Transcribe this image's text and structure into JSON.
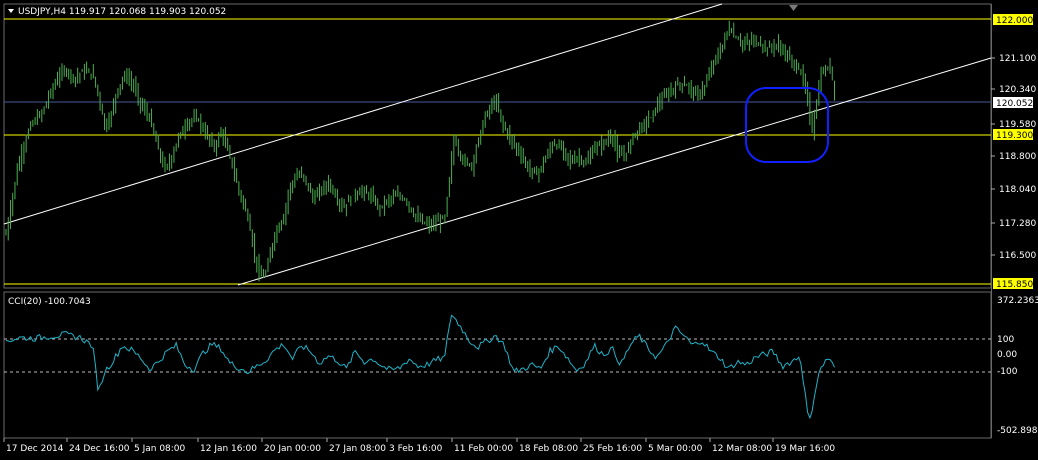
{
  "window": {
    "header_label": "USDJPY,H4  119.917 120.068 119.903 120.052",
    "indicator_label": "CCI(20) -100.7043"
  },
  "colors": {
    "background": "#000000",
    "candles": "#4caf50",
    "cci_line": "#1fb3c8",
    "trendline": "#ffffff",
    "hline_yellow": "#ffff00",
    "hline_blue": "#4a5a9a",
    "circle": "#1020ff",
    "frame": "#6a6a6a"
  },
  "price_axis": {
    "ticks": [
      "121.100",
      "120.340",
      "119.580",
      "118.800",
      "118.040",
      "117.280",
      "116.500"
    ]
  },
  "price_tags": {
    "top": "122.000",
    "current": "120.052",
    "support": "119.300",
    "bottom": "115.850"
  },
  "cci_axis": {
    "max": "372.2363",
    "plus100": "100",
    "zero": "0.00",
    "minus100": "-100",
    "min": "-502.8983"
  },
  "time_axis": {
    "labels": [
      "17 Dec 2014",
      "24 Dec 16:00",
      "5 Jan 08:00",
      "12 Jan 16:00",
      "20 Jan 00:00",
      "27 Jan 08:00",
      "3 Feb 16:00",
      "11 Feb 00:00",
      "18 Feb 08:00",
      "25 Feb 16:00",
      "5 Mar 00:00",
      "12 Mar 08:00",
      "19 Mar 16:00"
    ]
  },
  "chart_data": {
    "type": "candlestick",
    "symbol": "USDJPY",
    "timeframe": "H4",
    "ylim": [
      115.5,
      122.5
    ],
    "levels": [
      122.0,
      120.052,
      119.3,
      115.85
    ],
    "cci_ylim": [
      -502.8983,
      372.2363
    ],
    "cci_levels": [
      100,
      0,
      -100
    ],
    "close_path": [
      [
        0,
        117.0
      ],
      [
        8,
        118.6
      ],
      [
        16,
        119.5
      ],
      [
        24,
        119.8
      ],
      [
        30,
        120.3
      ],
      [
        36,
        120.7
      ],
      [
        40,
        120.8
      ],
      [
        46,
        120.6
      ],
      [
        52,
        120.8
      ],
      [
        58,
        120.7
      ],
      [
        62,
        120.2
      ],
      [
        66,
        119.5
      ],
      [
        70,
        119.7
      ],
      [
        74,
        120.3
      ],
      [
        80,
        120.7
      ],
      [
        86,
        120.4
      ],
      [
        90,
        120.0
      ],
      [
        96,
        119.7
      ],
      [
        100,
        119.2
      ],
      [
        106,
        118.5
      ],
      [
        110,
        118.7
      ],
      [
        116,
        119.3
      ],
      [
        122,
        119.6
      ],
      [
        128,
        119.7
      ],
      [
        134,
        119.3
      ],
      [
        140,
        119.0
      ],
      [
        144,
        119.4
      ],
      [
        150,
        118.8
      ],
      [
        156,
        118.0
      ],
      [
        162,
        117.4
      ],
      [
        166,
        116.6
      ],
      [
        170,
        116.0
      ],
      [
        174,
        116.1
      ],
      [
        180,
        117.0
      ],
      [
        186,
        117.4
      ],
      [
        190,
        118.1
      ],
      [
        196,
        118.4
      ],
      [
        200,
        118.3
      ],
      [
        206,
        117.8
      ],
      [
        210,
        118.0
      ],
      [
        216,
        118.2
      ],
      [
        222,
        117.8
      ],
      [
        226,
        117.6
      ],
      [
        232,
        117.9
      ],
      [
        238,
        118.0
      ],
      [
        244,
        117.9
      ],
      [
        250,
        117.6
      ],
      [
        256,
        117.8
      ],
      [
        262,
        117.9
      ],
      [
        268,
        117.8
      ],
      [
        272,
        117.5
      ],
      [
        278,
        117.3
      ],
      [
        284,
        117.2
      ],
      [
        290,
        117.3
      ],
      [
        294,
        117.4
      ],
      [
        300,
        119.2
      ],
      [
        306,
        118.7
      ],
      [
        312,
        118.6
      ],
      [
        318,
        119.4
      ],
      [
        322,
        119.8
      ],
      [
        328,
        120.1
      ],
      [
        332,
        119.6
      ],
      [
        338,
        119.2
      ],
      [
        344,
        118.9
      ],
      [
        350,
        118.5
      ],
      [
        356,
        118.4
      ],
      [
        362,
        118.8
      ],
      [
        366,
        119.1
      ],
      [
        372,
        119.0
      ],
      [
        378,
        118.7
      ],
      [
        384,
        118.8
      ],
      [
        388,
        118.6
      ],
      [
        394,
        119.0
      ],
      [
        400,
        119.1
      ],
      [
        406,
        119.3
      ],
      [
        410,
        118.8
      ],
      [
        416,
        118.9
      ],
      [
        420,
        119.3
      ],
      [
        426,
        119.5
      ],
      [
        432,
        119.7
      ],
      [
        436,
        120.0
      ],
      [
        442,
        120.2
      ],
      [
        448,
        120.4
      ],
      [
        452,
        120.5
      ],
      [
        458,
        120.4
      ],
      [
        462,
        120.2
      ],
      [
        468,
        120.4
      ],
      [
        474,
        121.0
      ],
      [
        478,
        121.2
      ],
      [
        484,
        121.8
      ],
      [
        488,
        121.6
      ],
      [
        494,
        121.4
      ],
      [
        500,
        121.5
      ],
      [
        506,
        121.4
      ],
      [
        510,
        121.3
      ],
      [
        516,
        121.4
      ],
      [
        522,
        121.2
      ],
      [
        526,
        121.0
      ],
      [
        532,
        120.8
      ],
      [
        536,
        120.3
      ],
      [
        540,
        119.4
      ],
      [
        546,
        120.7
      ],
      [
        552,
        120.9
      ],
      [
        556,
        120.1
      ]
    ],
    "cci_path": [
      [
        0,
        95
      ],
      [
        10,
        115
      ],
      [
        20,
        110
      ],
      [
        30,
        125
      ],
      [
        40,
        135
      ],
      [
        50,
        115
      ],
      [
        58,
        60
      ],
      [
        62,
        -260
      ],
      [
        66,
        -120
      ],
      [
        72,
        -40
      ],
      [
        78,
        60
      ],
      [
        84,
        30
      ],
      [
        90,
        -20
      ],
      [
        96,
        -100
      ],
      [
        102,
        -50
      ],
      [
        108,
        20
      ],
      [
        114,
        60
      ],
      [
        120,
        -70
      ],
      [
        126,
        -100
      ],
      [
        132,
        10
      ],
      [
        138,
        70
      ],
      [
        144,
        40
      ],
      [
        150,
        -60
      ],
      [
        156,
        -90
      ],
      [
        162,
        -120
      ],
      [
        168,
        -80
      ],
      [
        174,
        -40
      ],
      [
        180,
        30
      ],
      [
        186,
        70
      ],
      [
        192,
        -30
      ],
      [
        198,
        60
      ],
      [
        204,
        20
      ],
      [
        210,
        -60
      ],
      [
        216,
        -10
      ],
      [
        222,
        -40
      ],
      [
        228,
        -100
      ],
      [
        234,
        20
      ],
      [
        240,
        -50
      ],
      [
        246,
        -30
      ],
      [
        252,
        -80
      ],
      [
        258,
        -110
      ],
      [
        264,
        -90
      ],
      [
        270,
        -30
      ],
      [
        276,
        -80
      ],
      [
        282,
        -70
      ],
      [
        288,
        -40
      ],
      [
        294,
        -20
      ],
      [
        298,
        280
      ],
      [
        304,
        200
      ],
      [
        310,
        100
      ],
      [
        316,
        50
      ],
      [
        322,
        90
      ],
      [
        328,
        130
      ],
      [
        334,
        60
      ],
      [
        340,
        -120
      ],
      [
        346,
        -100
      ],
      [
        352,
        -70
      ],
      [
        358,
        -100
      ],
      [
        364,
        20
      ],
      [
        370,
        60
      ],
      [
        376,
        -20
      ],
      [
        382,
        -110
      ],
      [
        388,
        -60
      ],
      [
        394,
        60
      ],
      [
        400,
        0
      ],
      [
        406,
        40
      ],
      [
        412,
        -70
      ],
      [
        418,
        60
      ],
      [
        424,
        130
      ],
      [
        430,
        40
      ],
      [
        436,
        -20
      ],
      [
        442,
        60
      ],
      [
        448,
        180
      ],
      [
        454,
        130
      ],
      [
        460,
        60
      ],
      [
        466,
        100
      ],
      [
        472,
        20
      ],
      [
        478,
        -20
      ],
      [
        484,
        -100
      ],
      [
        490,
        -50
      ],
      [
        496,
        -70
      ],
      [
        502,
        -20
      ],
      [
        508,
        0
      ],
      [
        514,
        20
      ],
      [
        520,
        -80
      ],
      [
        526,
        -50
      ],
      [
        532,
        -10
      ],
      [
        538,
        -480
      ],
      [
        544,
        -140
      ],
      [
        550,
        -20
      ],
      [
        556,
        -101
      ]
    ]
  }
}
